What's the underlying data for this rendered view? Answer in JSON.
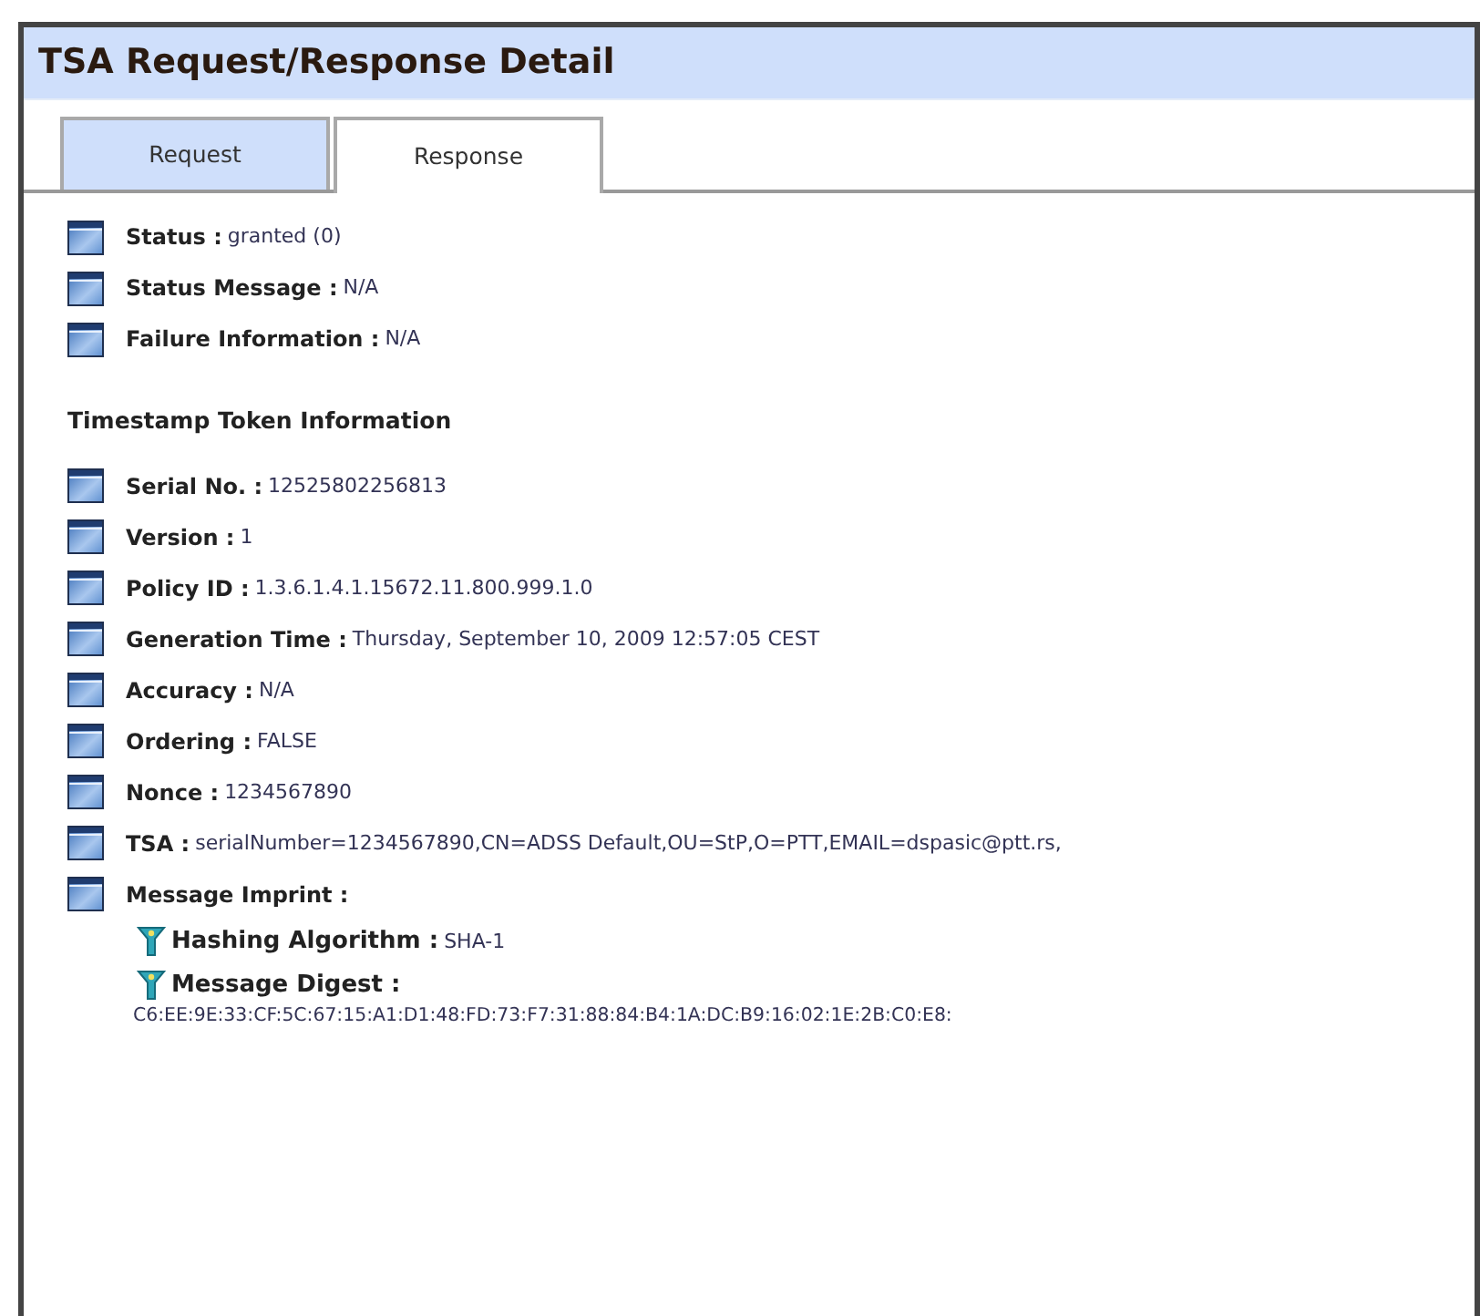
{
  "window": {
    "title": "TSA Request/Response Detail"
  },
  "tabs": [
    {
      "label": "Request",
      "selected": false
    },
    {
      "label": "Response",
      "selected": true
    }
  ],
  "status_fields": [
    {
      "label": "Status :",
      "value": "granted (0)"
    },
    {
      "label": "Status Message :",
      "value": "N/A"
    },
    {
      "label": "Failure Information :",
      "value": "N/A"
    }
  ],
  "section_heading": "Timestamp Token Information",
  "token_fields": [
    {
      "label": "Serial No. :",
      "value": "12525802256813"
    },
    {
      "label": "Version :",
      "value": "1"
    },
    {
      "label": "Policy ID :",
      "value": "1.3.6.1.4.1.15672.11.800.999.1.0"
    },
    {
      "label": "Generation Time :",
      "value": "Thursday, September 10, 2009 12:57:05 CEST"
    },
    {
      "label": "Accuracy :",
      "value": "N/A"
    },
    {
      "label": "Ordering :",
      "value": "FALSE"
    },
    {
      "label": "Nonce :",
      "value": "1234567890"
    },
    {
      "label": "TSA :",
      "value": "serialNumber=1234567890,CN=ADSS Default,OU=StP,O=PTT,EMAIL=dspasic@ptt.rs,"
    },
    {
      "label": "Message Imprint :",
      "children": [
        {
          "label": "Hashing Algorithm :",
          "value": "SHA-1",
          "kind": "inline"
        },
        {
          "label": "Message Digest :",
          "value": "C6:EE:9E:33:CF:5C:67:15:A1:D1:48:FD:73:F7:31:88:84:B4:1A:DC:B9:16:02:1E:2B:C0:E8:",
          "kind": "block"
        }
      ]
    }
  ]
}
